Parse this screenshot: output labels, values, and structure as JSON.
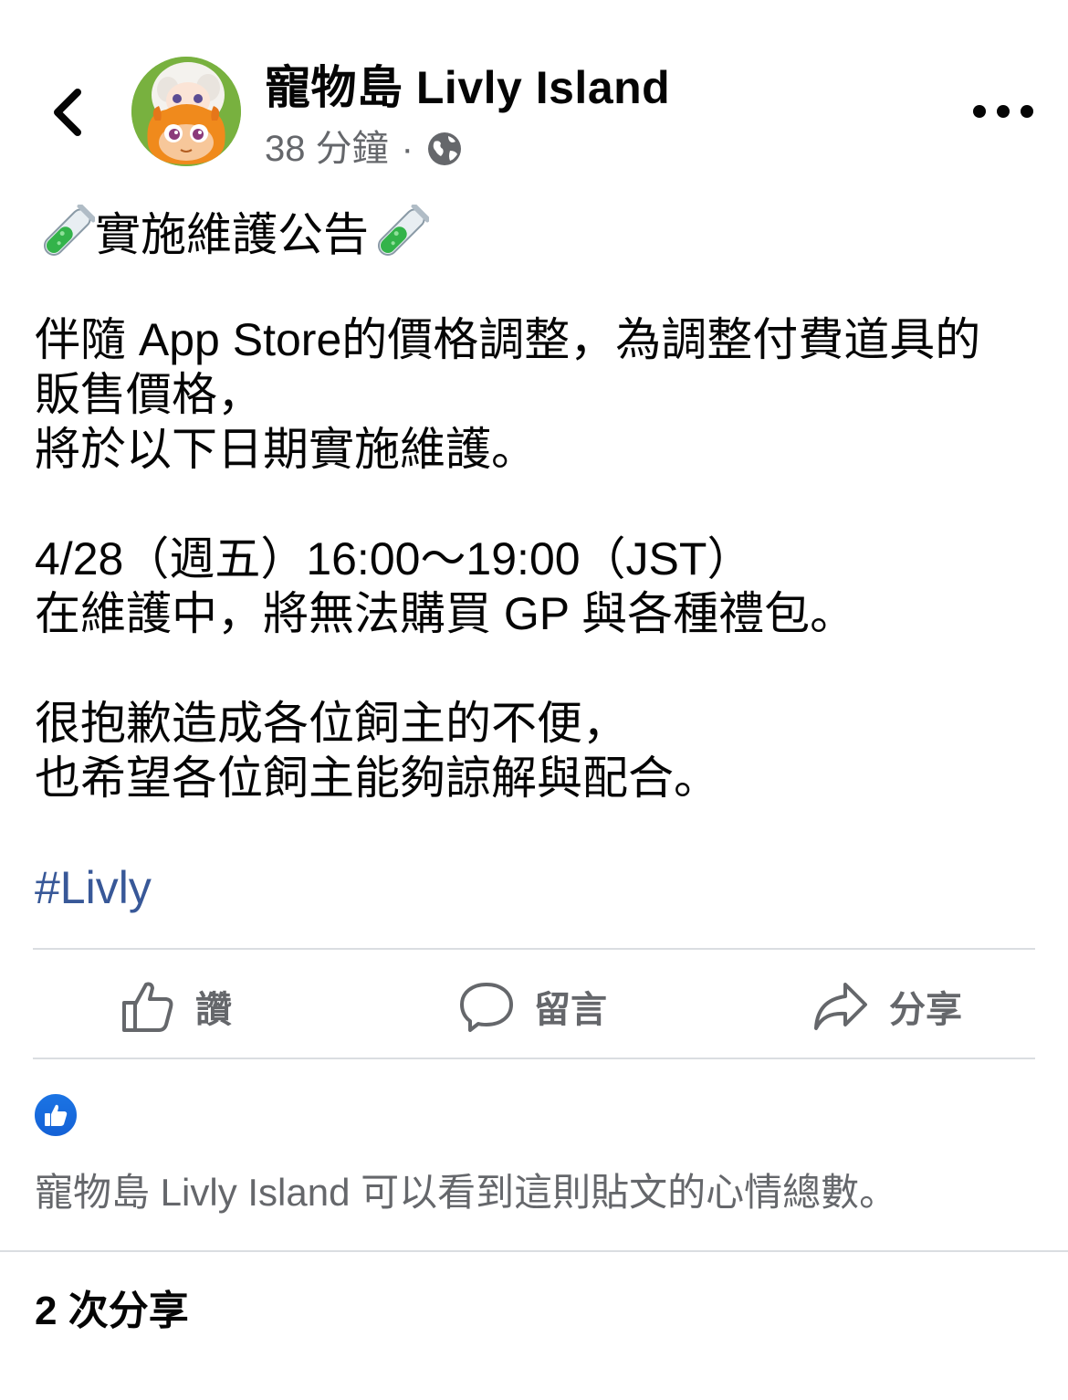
{
  "header": {
    "page_name": "寵物島 Livly Island",
    "time_ago": "38 分鐘",
    "separator": "·",
    "privacy_icon": "globe-icon",
    "back_icon": "chevron-left-icon",
    "more_icon": "more-horizontal-icon"
  },
  "post": {
    "title": "實施維護公告",
    "title_icon": "test-tube-emoji",
    "paragraphs": [
      "伴隨 App Store的價格調整，為調整付費道具的\n販售價格，\n將於以下日期實施維護。",
      "4/28（週五）16:00～19:00（JST）\n在維護中，將無法購買 GP 與各種禮包。",
      "很抱歉造成各位飼主的不便，\n也希望各位飼主能夠諒解與配合。"
    ],
    "hashtag": "#Livly"
  },
  "actions": {
    "like_label": "讚",
    "comment_label": "留言",
    "share_label": "分享"
  },
  "reactions": {
    "like_icon": "like-badge-icon",
    "note": "寵物島 Livly Island 可以看到這則貼文的心情總數。"
  },
  "shares": {
    "count_text": "2 次分享"
  },
  "colors": {
    "text": "#050505",
    "secondary": "#65676b",
    "link": "#385898",
    "divider": "#dadde1",
    "like_blue": "#1b74e4"
  }
}
